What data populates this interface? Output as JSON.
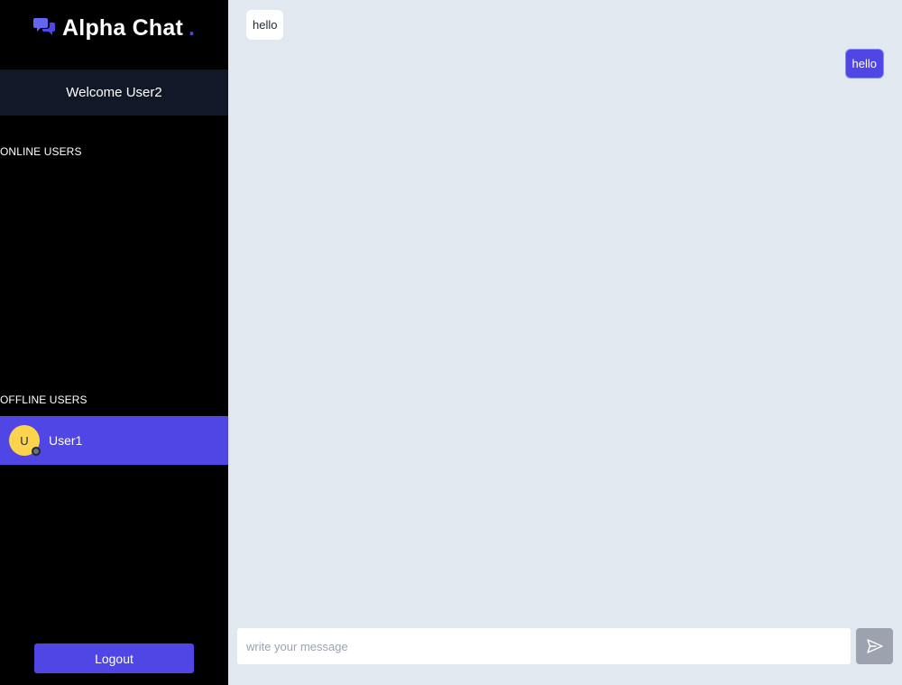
{
  "brand": {
    "title": "Alpha Chat",
    "dot": ".",
    "icon": "chat-bubbles-icon",
    "accent_color": "#4f46e5"
  },
  "sidebar": {
    "welcome_text": "Welcome User2",
    "online_label": "ONLINE USERS",
    "offline_label": "OFFLINE USERS",
    "offline_users": [
      {
        "initial": "U",
        "name": "User1",
        "status": "offline"
      }
    ],
    "logout_label": "Logout"
  },
  "chat": {
    "messages": [
      {
        "direction": "incoming",
        "text": "hello"
      },
      {
        "direction": "outgoing",
        "text": "hello"
      }
    ],
    "composer": {
      "placeholder": "write your message",
      "value": ""
    },
    "send_icon": "send-icon"
  },
  "colors": {
    "sidebar_bg": "#000000",
    "welcome_bg": "#111827",
    "chat_bg": "#e2e8f0",
    "primary": "#4f46e5",
    "avatar_bg": "#fcd34d",
    "send_button_bg": "#9ca3af"
  }
}
